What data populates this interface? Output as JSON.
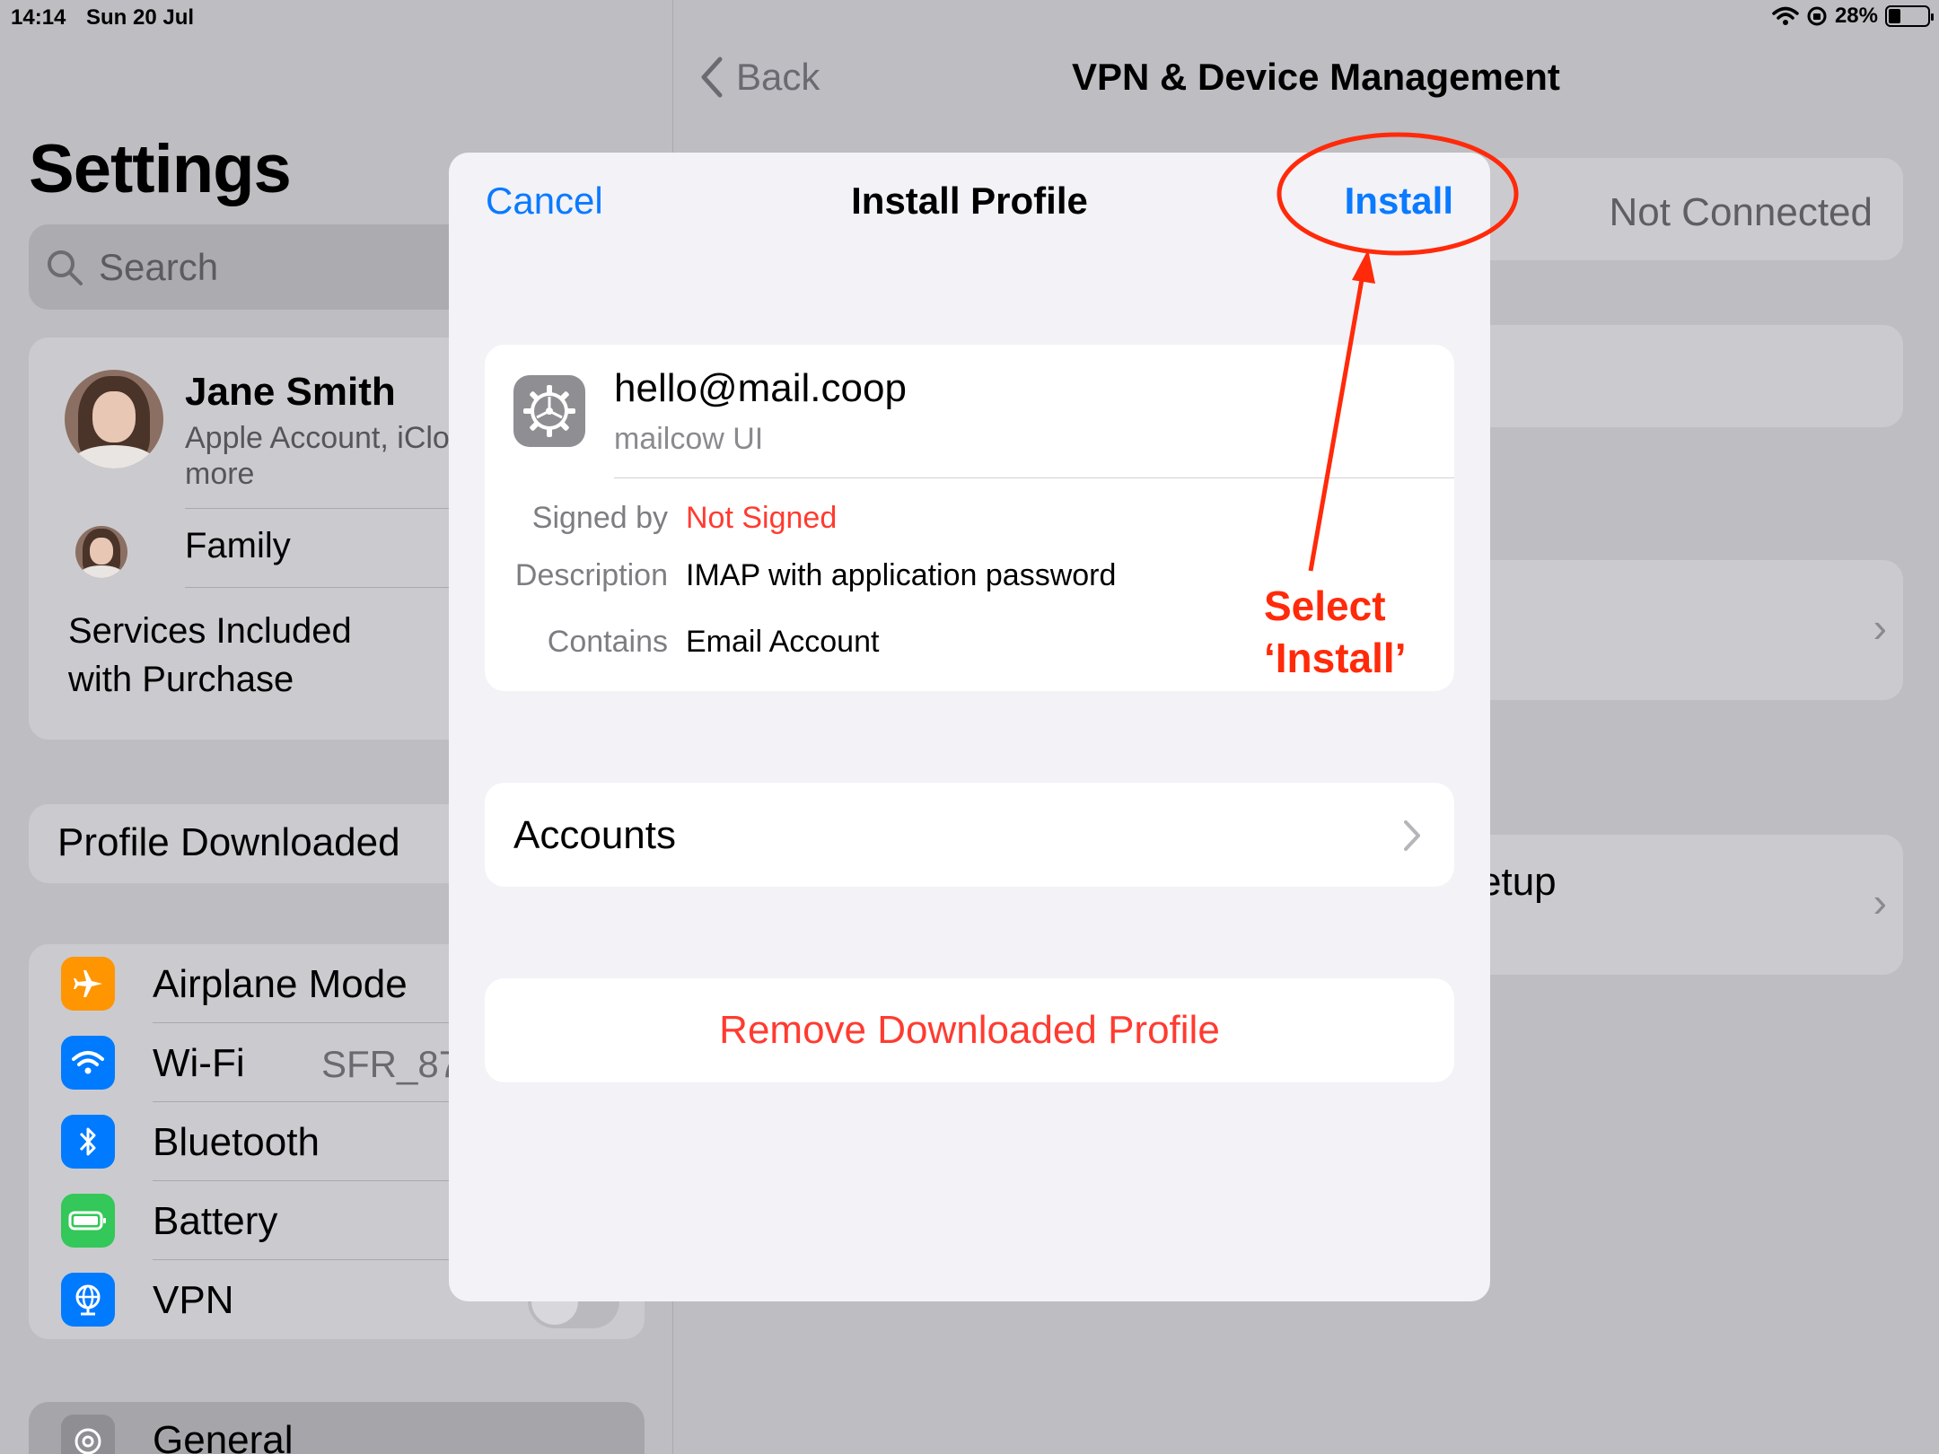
{
  "status_bar": {
    "time": "14:14",
    "date": "Sun 20 Jul",
    "battery": "28%"
  },
  "sidebar": {
    "title": "Settings",
    "search_placeholder": "Search",
    "account": {
      "name": "Jane Smith",
      "subtitle": "Apple Account, iCloud and more",
      "family": "Family",
      "services": "Services Included with Purchase"
    },
    "profile_downloaded": "Profile Downloaded",
    "items": [
      {
        "label": "Airplane Mode",
        "value": "",
        "icon": "airplane-icon",
        "color": "#ff9500"
      },
      {
        "label": "Wi-Fi",
        "value": "SFR_879",
        "icon": "wifi-icon",
        "color": "#007aff"
      },
      {
        "label": "Bluetooth",
        "value": "",
        "icon": "bluetooth-icon",
        "color": "#007aff"
      },
      {
        "label": "Battery",
        "value": "",
        "icon": "battery-icon",
        "color": "#34c759"
      },
      {
        "label": "VPN",
        "value": "",
        "icon": "globe-icon",
        "color": "#007aff"
      }
    ],
    "general": "General"
  },
  "detail": {
    "back_label": "Back",
    "title": "VPN & Device Management",
    "vpn_status": "Not Connected",
    "partial_row": "etup"
  },
  "modal": {
    "cancel": "Cancel",
    "title": "Install Profile",
    "install": "Install",
    "profile": {
      "name": "hello@mail.coop",
      "organization": "mailcow UI",
      "signed_by_label": "Signed by",
      "signed_by_value": "Not Signed",
      "description_label": "Description",
      "description_value": "IMAP with application password",
      "contains_label": "Contains",
      "contains_value": "Email Account"
    },
    "accounts": "Accounts",
    "remove": "Remove Downloaded Profile"
  },
  "annotation": {
    "line1": "Select",
    "line2": "‘Install’",
    "color": "#ff2a0a"
  },
  "colors": {
    "accent": "#0a7aff",
    "destructive": "#ff3b30"
  }
}
